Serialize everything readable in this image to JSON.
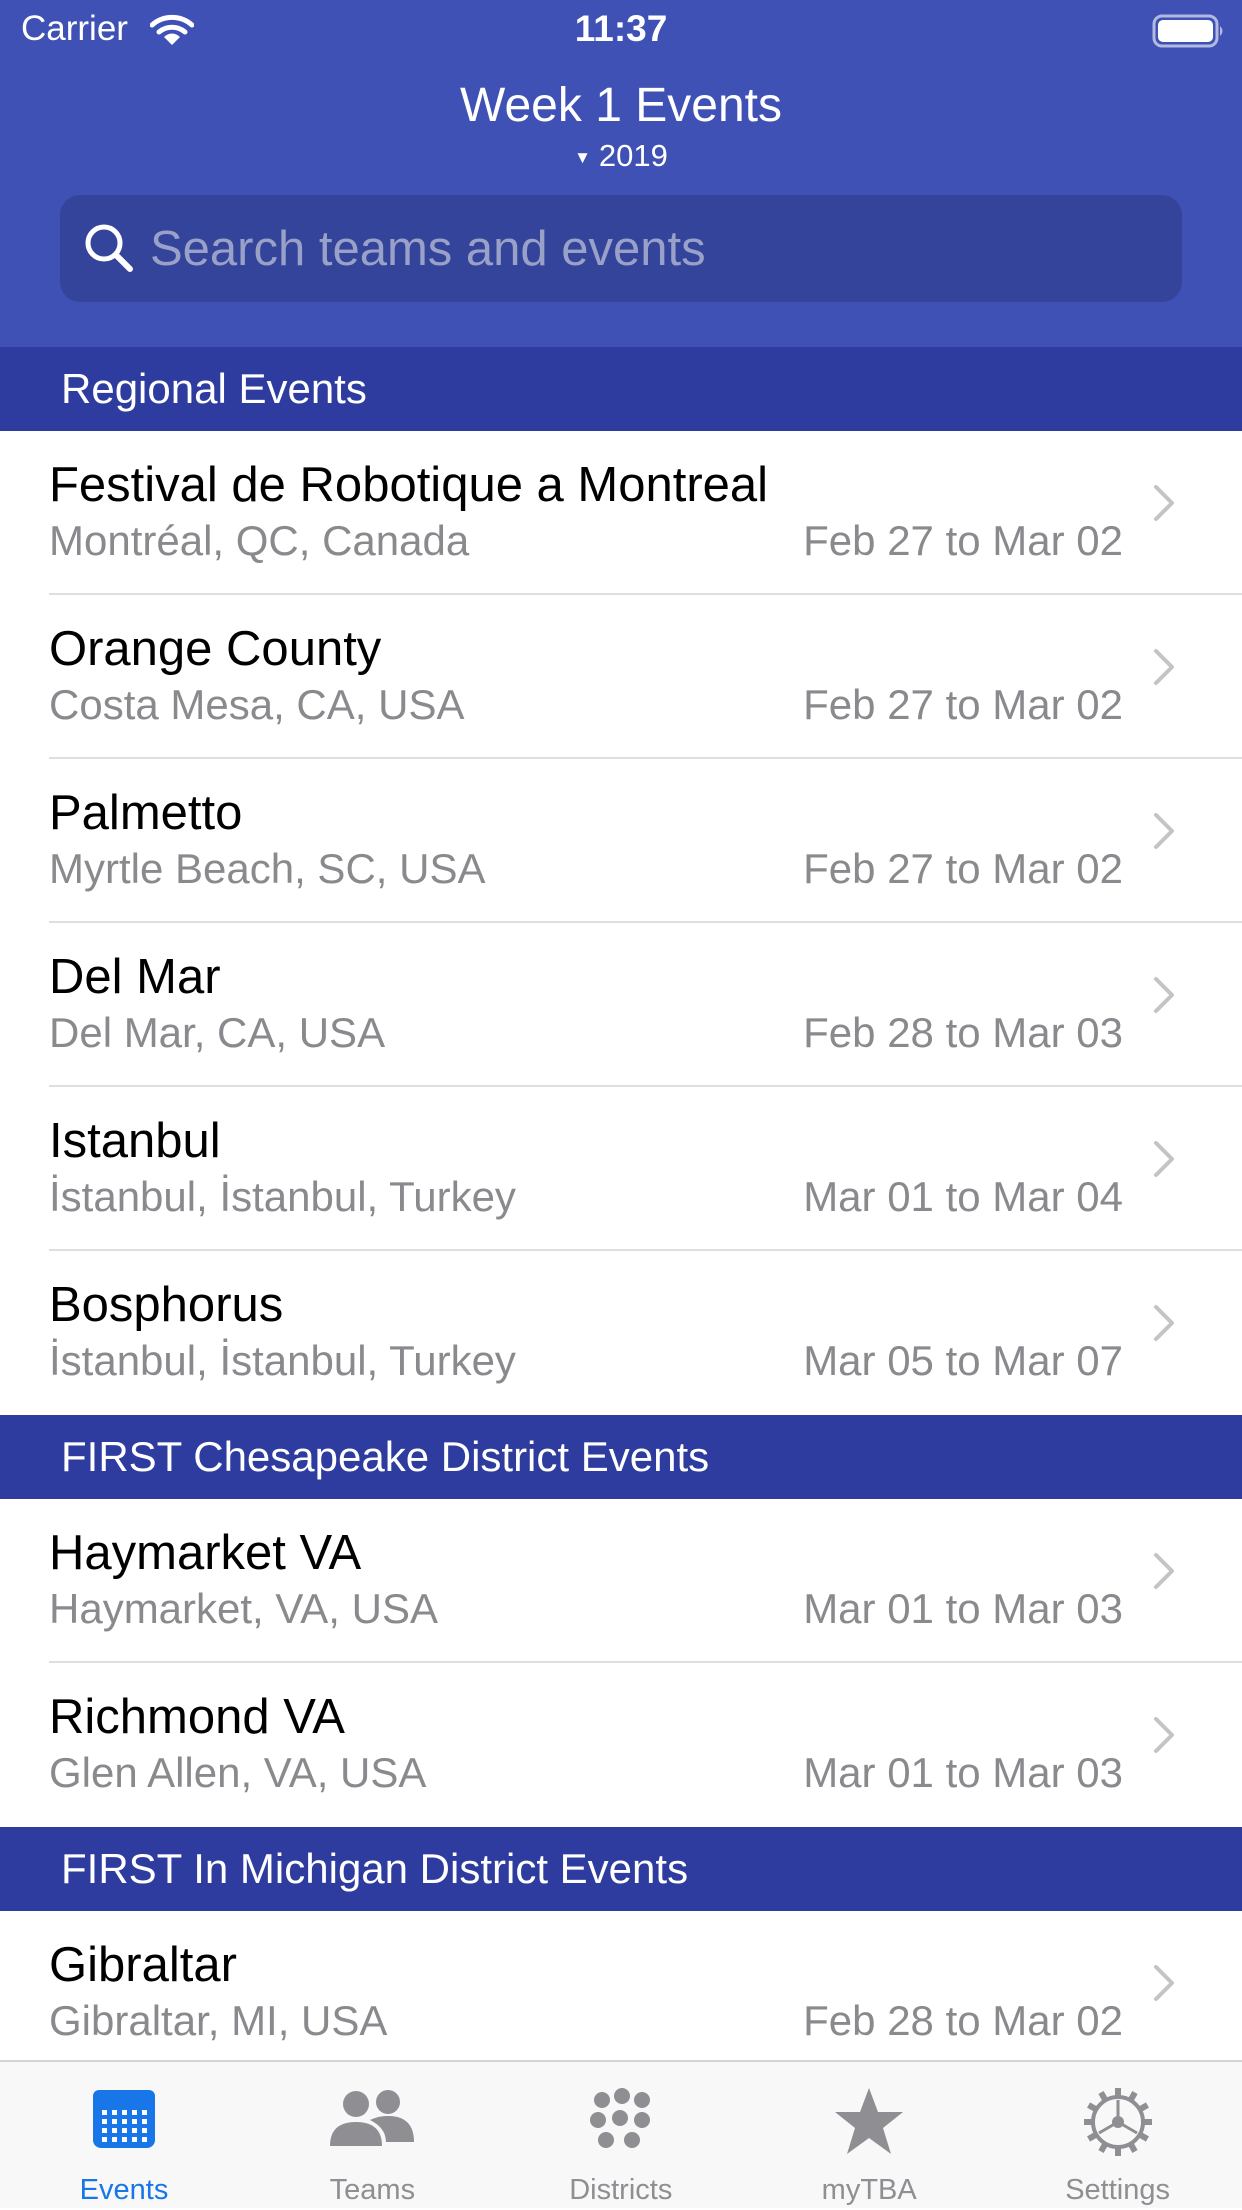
{
  "status_bar": {
    "carrier": "Carrier",
    "time": "11:37"
  },
  "nav": {
    "title": "Week 1 Events",
    "subtitle": "2019"
  },
  "search": {
    "placeholder": "Search teams and events"
  },
  "sections": [
    {
      "title": "Regional Events",
      "events": [
        {
          "name": "Festival de Robotique a Montreal",
          "location": "Montréal, QC, Canada",
          "dates": "Feb 27 to Mar 02"
        },
        {
          "name": "Orange County",
          "location": "Costa Mesa, CA, USA",
          "dates": "Feb 27 to Mar 02"
        },
        {
          "name": "Palmetto",
          "location": "Myrtle Beach, SC, USA",
          "dates": "Feb 27 to Mar 02"
        },
        {
          "name": "Del Mar",
          "location": "Del Mar, CA, USA",
          "dates": "Feb 28 to Mar 03"
        },
        {
          "name": "Istanbul",
          "location": "İstanbul, İstanbul, Turkey",
          "dates": "Mar 01 to Mar 04"
        },
        {
          "name": "Bosphorus",
          "location": "İstanbul, İstanbul, Turkey",
          "dates": "Mar 05 to Mar 07"
        }
      ]
    },
    {
      "title": "FIRST Chesapeake District Events",
      "events": [
        {
          "name": "Haymarket VA",
          "location": "Haymarket, VA, USA",
          "dates": "Mar 01 to Mar 03"
        },
        {
          "name": "Richmond VA",
          "location": "Glen Allen, VA, USA",
          "dates": "Mar 01 to Mar 03"
        }
      ]
    },
    {
      "title": "FIRST In Michigan District Events",
      "events": [
        {
          "name": "Gibraltar",
          "location": "Gibraltar, MI, USA",
          "dates": "Feb 28 to Mar 02"
        }
      ]
    }
  ],
  "tabs": [
    {
      "label": "Events",
      "icon": "calendar-icon",
      "active": true
    },
    {
      "label": "Teams",
      "icon": "people-icon",
      "active": false
    },
    {
      "label": "Districts",
      "icon": "districts-icon",
      "active": false
    },
    {
      "label": "myTBA",
      "icon": "star-icon",
      "active": false
    },
    {
      "label": "Settings",
      "icon": "gear-icon",
      "active": false
    }
  ],
  "colors": {
    "nav_background": "#3f51b5",
    "section_background": "#2e3c9f",
    "active_tab": "#1976e8",
    "inactive_tab": "#8e8e93",
    "secondary_text": "#8a8a8e"
  }
}
